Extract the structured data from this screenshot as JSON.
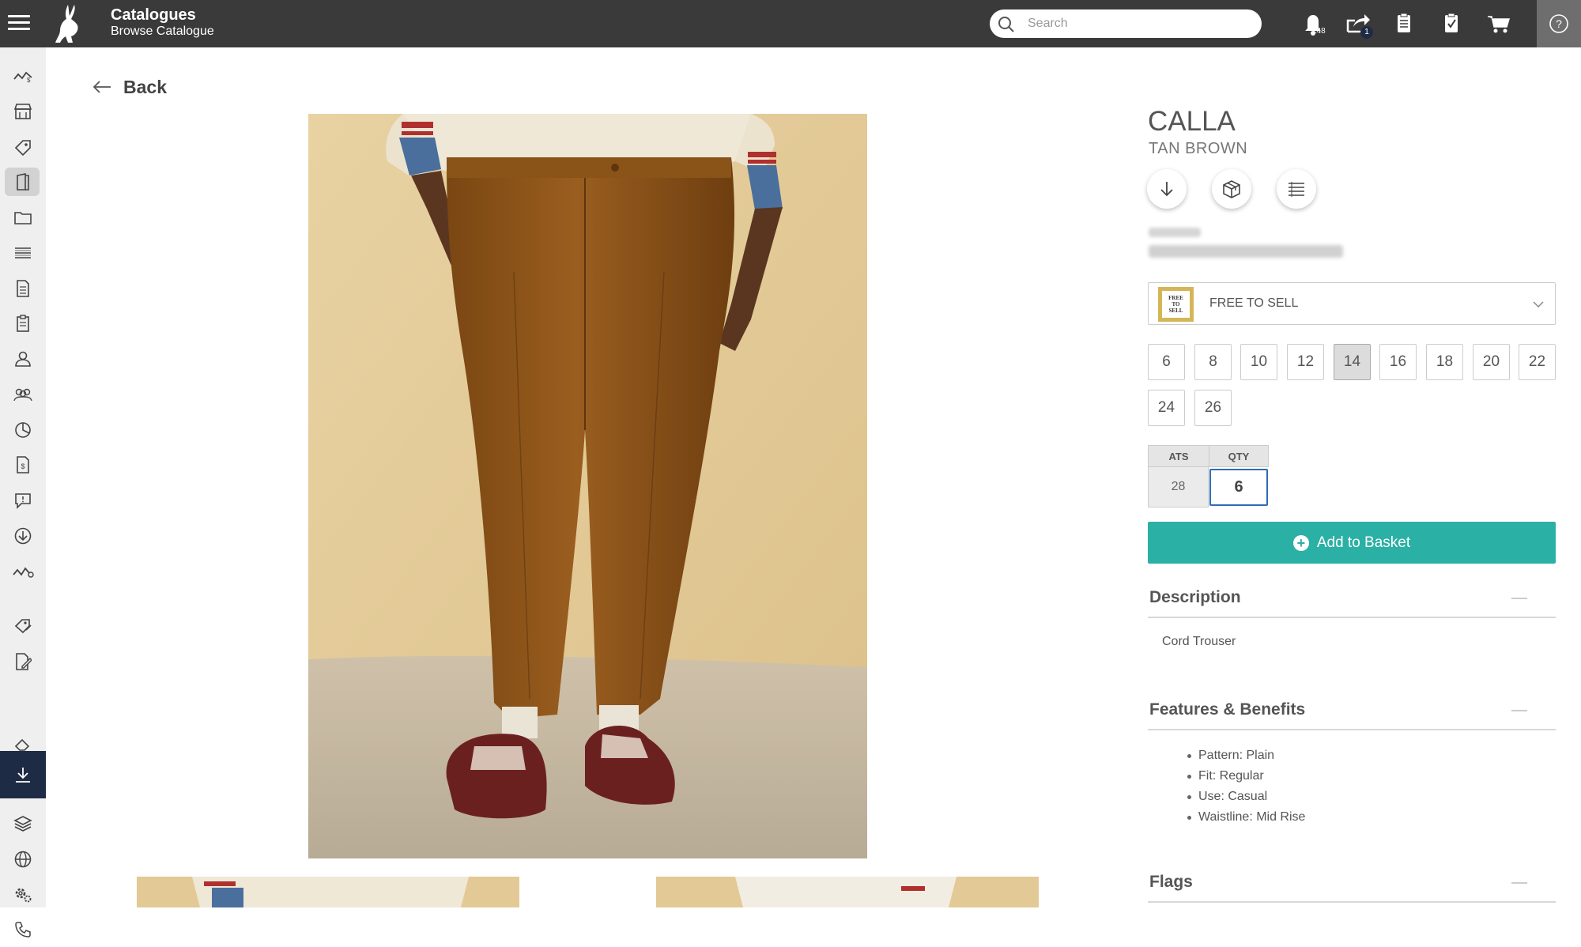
{
  "header": {
    "title": "Catalogues",
    "subtitle": "Browse Catalogue",
    "search_placeholder": "Search",
    "notifications_count": "148",
    "share_count": "1"
  },
  "sidebar": {
    "items": [
      "analytics-icon",
      "store-icon",
      "tag-icon",
      "catalogue-icon",
      "folder-icon",
      "list-icon",
      "document-icon",
      "clipboard-icon",
      "user-icon",
      "users-icon",
      "pie-chart-icon",
      "invoice-icon",
      "chat-icon",
      "download-circle-icon",
      "trend-icon",
      "tag-edit-icon",
      "document-edit-icon",
      "eraser-icon",
      "download-icon",
      "layers-icon",
      "globe-icon",
      "settings-icon",
      "phone-icon"
    ]
  },
  "back_label": "Back",
  "product": {
    "name": "CALLA",
    "colour": "TAN BROWN",
    "status": "FREE TO SELL",
    "status_logo_text": "FREE TO SELL",
    "sizes": [
      "6",
      "8",
      "10",
      "12",
      "14",
      "16",
      "18",
      "20",
      "22",
      "24",
      "26"
    ],
    "selected_size": "14",
    "ats_label": "ATS",
    "qty_label": "QTY",
    "ats_value": "28",
    "qty_value": "6",
    "add_to_basket": "Add to Basket"
  },
  "sections": {
    "description_title": "Description",
    "description_text": "Cord Trouser",
    "features_title": "Features & Benefits",
    "features": [
      "Pattern: Plain",
      "Fit: Regular",
      "Use: Casual",
      "Waistline: Mid Rise"
    ],
    "flags_title": "Flags"
  },
  "colors": {
    "topbar": "#3a3a3a",
    "sidebar": "#efefef",
    "sidebar_active": "#1e2b45",
    "accent": "#2bb0a5",
    "qty_border": "#2f6db5",
    "trouser": "#8a5318",
    "backdrop": "#e3c995"
  }
}
